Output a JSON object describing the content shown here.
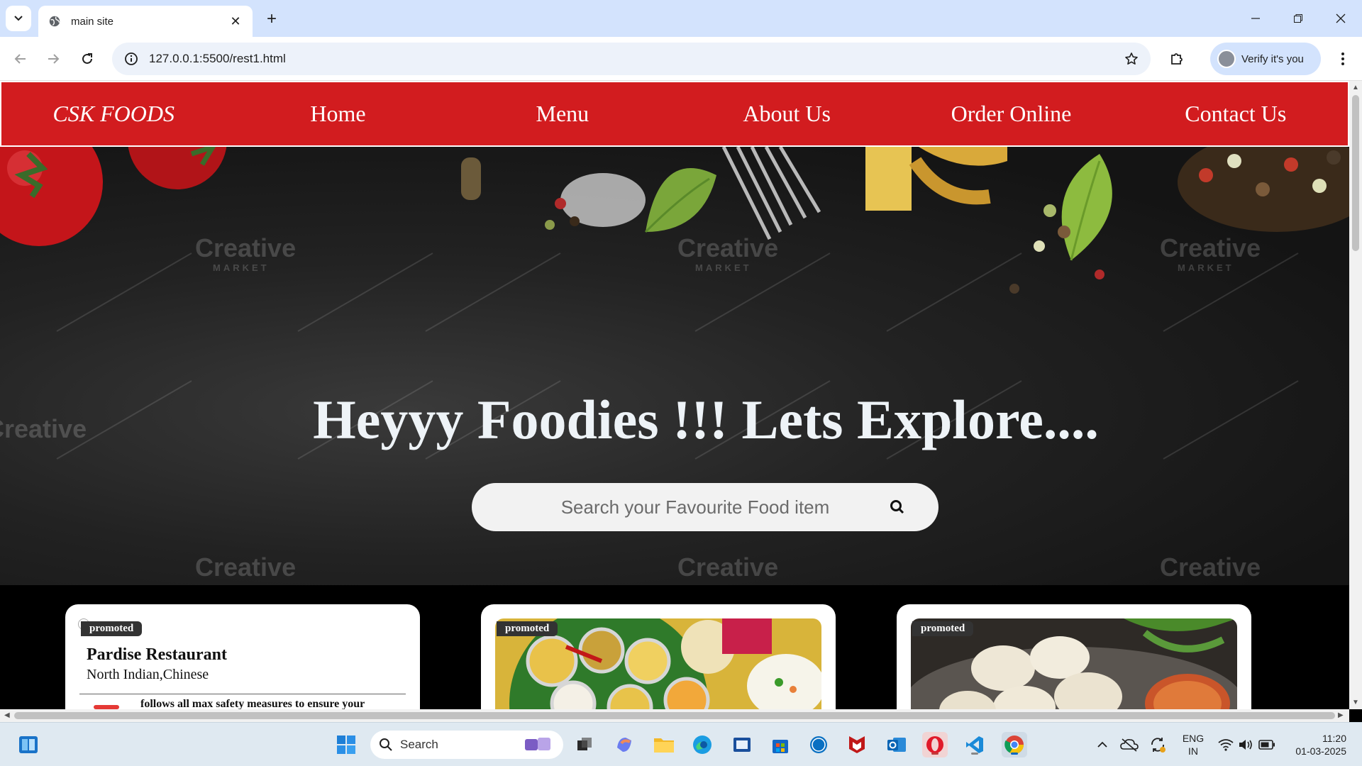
{
  "browser": {
    "tab_title": "main site",
    "url": "127.0.0.1:5500/rest1.html",
    "profile_label": "Verify it's you"
  },
  "site": {
    "nav": {
      "brand": "CSK FOODS",
      "items": [
        "Home",
        "Menu",
        "About Us",
        "Order Online",
        "Contact Us"
      ]
    },
    "hero": {
      "title": "Heyyy Foodies !!! Lets Explore....",
      "watermark": "Creative",
      "watermark_sub": "MARKET",
      "search_placeholder": "Search your Favourite Food item"
    },
    "cards": [
      {
        "badge": "promoted",
        "name": "Pardise Restaurant",
        "cuisine": "North Indian,Chinese",
        "note": "follows all max safety measures to ensure your"
      },
      {
        "badge": "promoted",
        "image": "thali"
      },
      {
        "badge": "promoted",
        "image": "momos"
      }
    ]
  },
  "taskbar": {
    "search_label": "Search",
    "lang_top": "ENG",
    "lang_bottom": "IN",
    "time": "11:20",
    "date": "01-03-2025"
  },
  "colors": {
    "brand_red": "#d21c1f",
    "tab_strip": "#d3e3fd",
    "omnibox": "#edf2fa"
  }
}
